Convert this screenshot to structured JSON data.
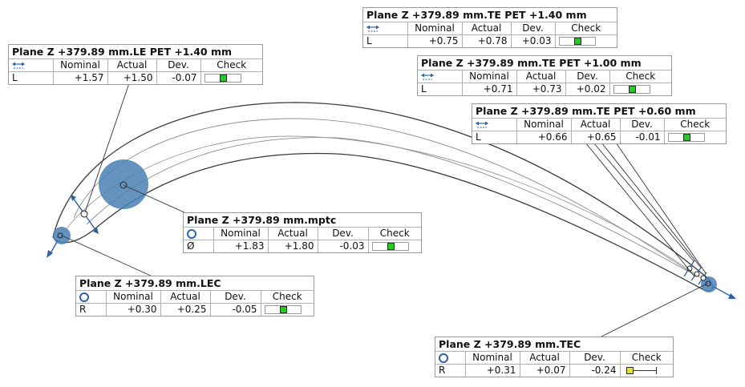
{
  "colors": {
    "ok": "#22cc22",
    "warn": "#e8e030",
    "feature": "#4a80b4",
    "symbol": "#2c63a8",
    "outline": "#333333"
  },
  "callouts": [
    {
      "id": "le",
      "title": "Plane Z +379.89 mm.LE PET +1.40 mm",
      "headers": [
        "Nominal",
        "Actual",
        "Dev.",
        "Check"
      ],
      "symbol_icon": "width-arrows-icon",
      "row": {
        "label": "L",
        "nominal": "+1.57",
        "actual": "+1.50",
        "dev": "-0.07",
        "status": "ok"
      },
      "check_fraction": 0.5
    },
    {
      "id": "te140",
      "title": "Plane Z +379.89 mm.TE PET +1.40 mm",
      "headers": [
        "Nominal",
        "Actual",
        "Dev.",
        "Check"
      ],
      "symbol_icon": "width-arrows-icon",
      "row": {
        "label": "L",
        "nominal": "+0.75",
        "actual": "+0.78",
        "dev": "+0.03",
        "status": "ok"
      },
      "check_fraction": 0.5
    },
    {
      "id": "te100",
      "title": "Plane Z +379.89 mm.TE PET +1.00 mm",
      "headers": [
        "Nominal",
        "Actual",
        "Dev.",
        "Check"
      ],
      "symbol_icon": "width-arrows-icon",
      "row": {
        "label": "L",
        "nominal": "+0.71",
        "actual": "+0.73",
        "dev": "+0.02",
        "status": "ok"
      },
      "check_fraction": 0.5
    },
    {
      "id": "te060",
      "title": "Plane Z +379.89 mm.TE PET +0.60 mm",
      "headers": [
        "Nominal",
        "Actual",
        "Dev.",
        "Check"
      ],
      "symbol_icon": "width-arrows-icon",
      "row": {
        "label": "L",
        "nominal": "+0.66",
        "actual": "+0.65",
        "dev": "-0.01",
        "status": "ok"
      },
      "check_fraction": 0.5
    },
    {
      "id": "mptc",
      "title": "Plane Z +379.89 mm.mptc",
      "headers": [
        "Nominal",
        "Actual",
        "Dev.",
        "Check"
      ],
      "symbol_icon": "circle-icon",
      "row": {
        "label": "Ø",
        "nominal": "+1.83",
        "actual": "+1.80",
        "dev": "-0.03",
        "status": "ok"
      },
      "check_fraction": 0.5
    },
    {
      "id": "lec",
      "title": "Plane Z +379.89 mm.LEC",
      "headers": [
        "Nominal",
        "Actual",
        "Dev.",
        "Check"
      ],
      "symbol_icon": "circle-icon",
      "row": {
        "label": "R",
        "nominal": "+0.30",
        "actual": "+0.25",
        "dev": "-0.05",
        "status": "ok"
      },
      "check_fraction": 0.5
    },
    {
      "id": "tec",
      "title": "Plane Z +379.89 mm.TEC",
      "headers": [
        "Nominal",
        "Actual",
        "Dev.",
        "Check"
      ],
      "symbol_icon": "circle-icon",
      "row": {
        "label": "R",
        "nominal": "+0.31",
        "actual": "+0.07",
        "dev": "-0.24",
        "status": "warn"
      },
      "check_fraction": 0.05
    }
  ]
}
